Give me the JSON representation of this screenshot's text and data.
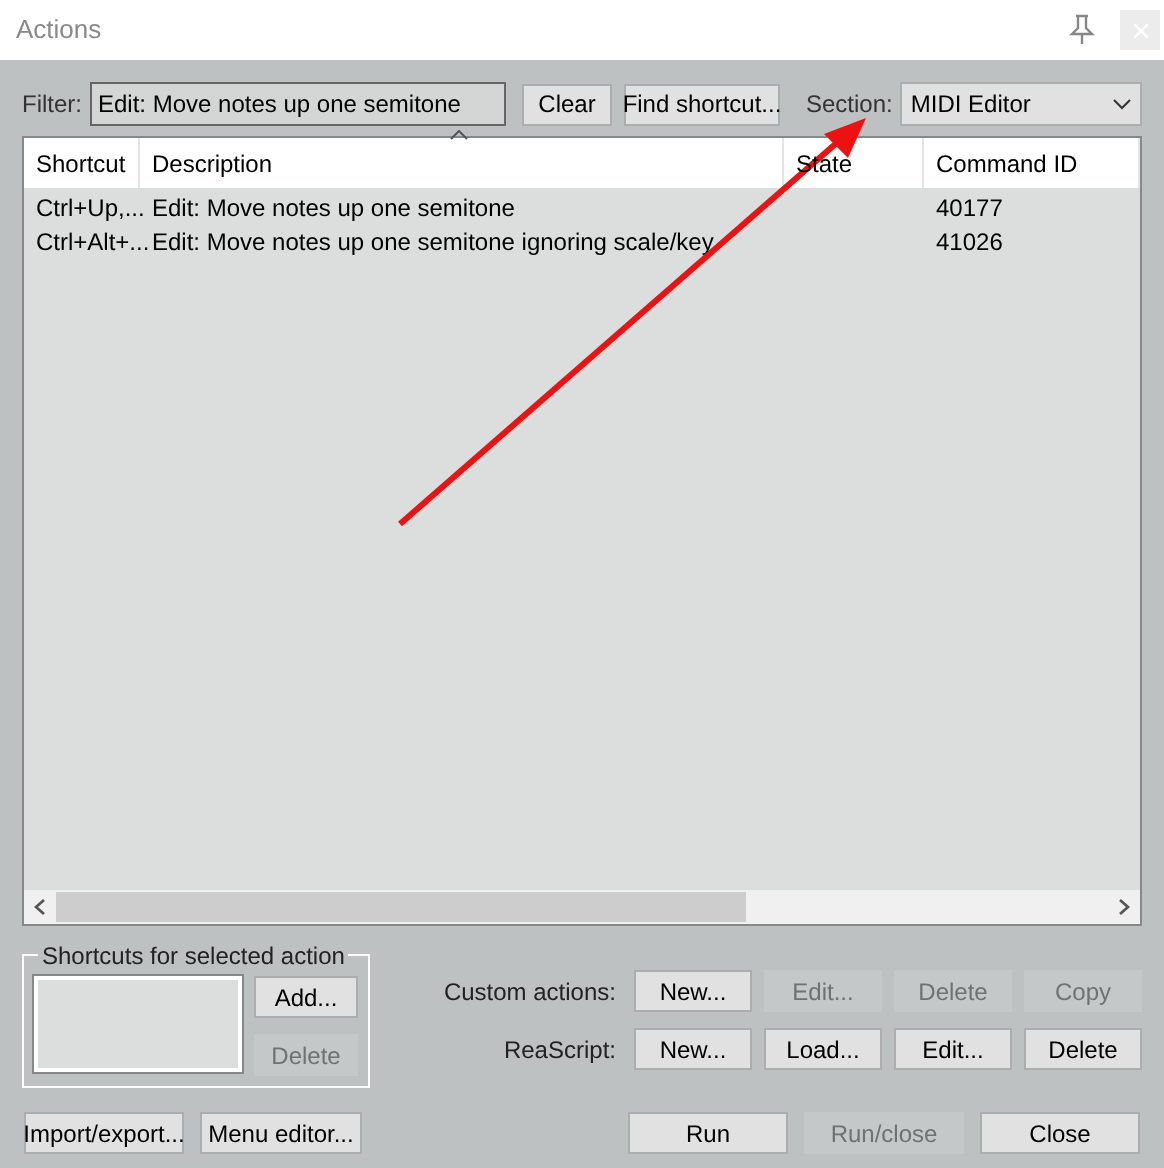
{
  "window": {
    "title": "Actions"
  },
  "filter": {
    "label": "Filter:",
    "value": "Edit: Move notes up one semitone"
  },
  "filter_buttons": [
    {
      "label": "Clear",
      "disabled": false
    },
    {
      "label": "Find shortcut...",
      "disabled": false
    }
  ],
  "section": {
    "label": "Section:",
    "value": "MIDI Editor"
  },
  "table": {
    "columns": [
      "Shortcut",
      "Description",
      "State",
      "Command ID"
    ],
    "rows": [
      {
        "shortcut": "Ctrl+Up,...",
        "description": "Edit: Move notes up one semitone",
        "state": "",
        "command_id": "40177"
      },
      {
        "shortcut": "Ctrl+Alt+...",
        "description": "Edit: Move notes up one semitone ignoring scale/key",
        "state": "",
        "command_id": "41026"
      }
    ]
  },
  "shortcuts_group": {
    "title": "Shortcuts for selected action",
    "buttons": [
      {
        "label": "Add...",
        "disabled": false
      },
      {
        "label": "Delete",
        "disabled": true
      }
    ]
  },
  "custom_actions": {
    "label": "Custom actions:",
    "buttons": [
      {
        "label": "New...",
        "disabled": false
      },
      {
        "label": "Edit...",
        "disabled": true
      },
      {
        "label": "Delete",
        "disabled": true
      },
      {
        "label": "Copy",
        "disabled": true
      }
    ]
  },
  "reascript": {
    "label": "ReaScript:",
    "buttons": [
      {
        "label": "New...",
        "disabled": false
      },
      {
        "label": "Load...",
        "disabled": false
      },
      {
        "label": "Edit...",
        "disabled": false
      },
      {
        "label": "Delete",
        "disabled": false
      }
    ]
  },
  "bottom_left_buttons": [
    {
      "label": "Import/export...",
      "disabled": false
    },
    {
      "label": "Menu editor...",
      "disabled": false
    }
  ],
  "bottom_right_buttons": [
    {
      "label": "Run",
      "disabled": false
    },
    {
      "label": "Run/close",
      "disabled": true
    },
    {
      "label": "Close",
      "disabled": false
    }
  ]
}
